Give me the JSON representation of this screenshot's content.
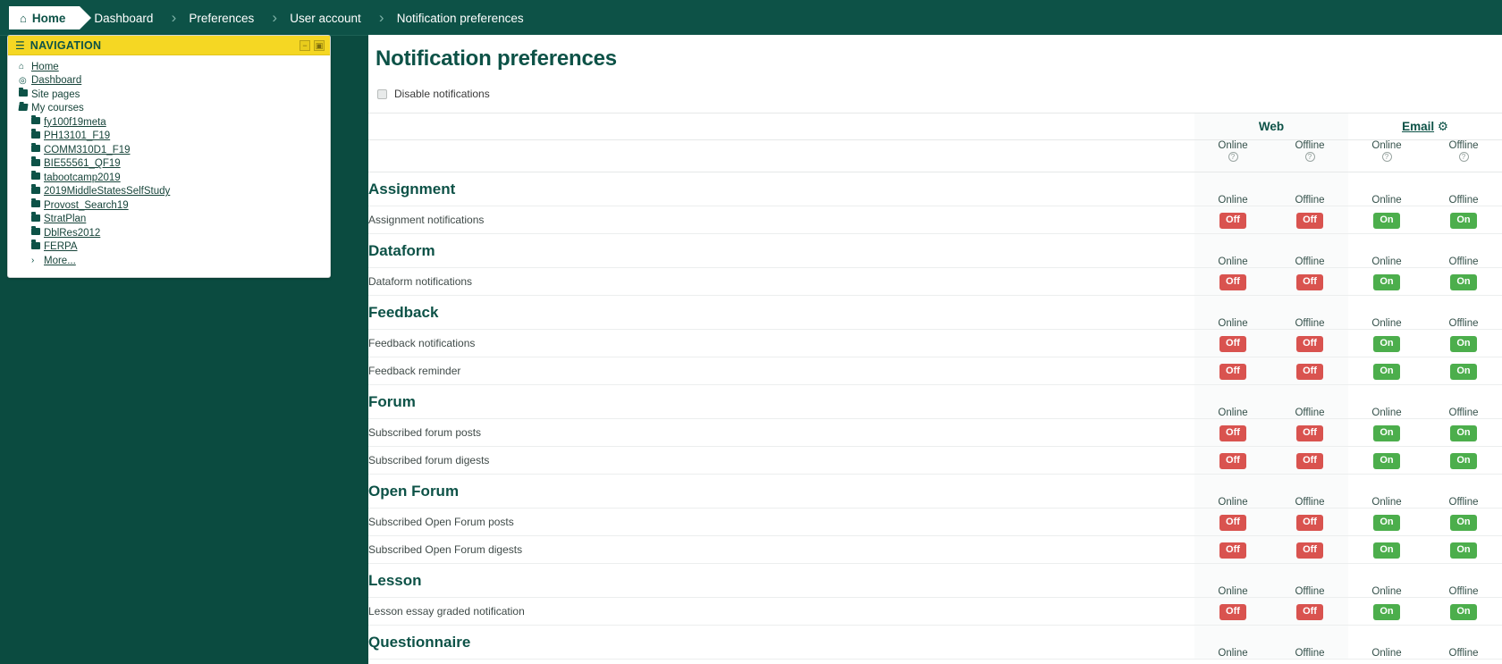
{
  "breadcrumb": {
    "home_label": "Home",
    "home_icon": "home-icon",
    "items": [
      {
        "label": "Dashboard"
      },
      {
        "label": "Preferences"
      },
      {
        "label": "User account"
      },
      {
        "label": "Notification preferences"
      }
    ],
    "separator": "›"
  },
  "sidebar": {
    "title": "NAVIGATION",
    "block_icon": "sitemap-icon",
    "controls": [
      {
        "name": "collapse-block-button",
        "glyph": "−"
      },
      {
        "name": "dock-block-button",
        "glyph": "▣"
      }
    ],
    "items": [
      {
        "label": "Home",
        "icon": "home-icon",
        "level": 1,
        "link": true
      },
      {
        "label": "Dashboard",
        "icon": "dashboard-icon",
        "level": 1,
        "link": true
      },
      {
        "label": "Site pages",
        "icon": "folder-icon",
        "level": 1,
        "link": false
      },
      {
        "label": "My courses",
        "icon": "folder-open-icon",
        "level": 1,
        "link": false
      },
      {
        "label": "fy100f19meta",
        "icon": "folder-icon",
        "level": 2,
        "link": true
      },
      {
        "label": "PH13101_F19",
        "icon": "folder-icon",
        "level": 2,
        "link": true
      },
      {
        "label": "COMM310D1_F19",
        "icon": "folder-icon",
        "level": 2,
        "link": true
      },
      {
        "label": "BIE55561_QF19",
        "icon": "folder-icon",
        "level": 2,
        "link": true
      },
      {
        "label": "tabootcamp2019",
        "icon": "folder-icon",
        "level": 2,
        "link": true
      },
      {
        "label": "2019MiddleStatesSelfStudy",
        "icon": "folder-icon",
        "level": 2,
        "link": true
      },
      {
        "label": "Provost_Search19",
        "icon": "folder-icon",
        "level": 2,
        "link": true
      },
      {
        "label": "StratPlan",
        "icon": "folder-icon",
        "level": 2,
        "link": true
      },
      {
        "label": "DblRes2012",
        "icon": "folder-icon",
        "level": 2,
        "link": true
      },
      {
        "label": "FERPA",
        "icon": "folder-icon",
        "level": 2,
        "link": true
      },
      {
        "label": "More...",
        "icon": "chevron-right-icon",
        "level": 3,
        "link": true
      }
    ]
  },
  "main": {
    "title": "Notification preferences",
    "disable_notifications": {
      "label": "Disable notifications",
      "checked": false
    },
    "providers": [
      {
        "name": "Web",
        "link": false,
        "gear": false
      },
      {
        "name": "Email",
        "link": true,
        "gear": true,
        "gear_icon": "gear-icon"
      }
    ],
    "state_columns": [
      "Online",
      "Offline",
      "Online",
      "Offline"
    ],
    "help_glyph": "?",
    "toggle_on_label": "On",
    "toggle_off_label": "Off",
    "sections": [
      {
        "title": "Assignment",
        "rows": [
          {
            "label": "Assignment notifications",
            "states": [
              "Off",
              "Off",
              "On",
              "On"
            ]
          }
        ]
      },
      {
        "title": "Dataform",
        "rows": [
          {
            "label": "Dataform notifications",
            "states": [
              "Off",
              "Off",
              "On",
              "On"
            ]
          }
        ]
      },
      {
        "title": "Feedback",
        "rows": [
          {
            "label": "Feedback notifications",
            "states": [
              "Off",
              "Off",
              "On",
              "On"
            ]
          },
          {
            "label": "Feedback reminder",
            "states": [
              "Off",
              "Off",
              "On",
              "On"
            ]
          }
        ]
      },
      {
        "title": "Forum",
        "rows": [
          {
            "label": "Subscribed forum posts",
            "states": [
              "Off",
              "Off",
              "On",
              "On"
            ]
          },
          {
            "label": "Subscribed forum digests",
            "states": [
              "Off",
              "Off",
              "On",
              "On"
            ]
          }
        ]
      },
      {
        "title": "Open Forum",
        "rows": [
          {
            "label": "Subscribed Open Forum posts",
            "states": [
              "Off",
              "Off",
              "On",
              "On"
            ]
          },
          {
            "label": "Subscribed Open Forum digests",
            "states": [
              "Off",
              "Off",
              "On",
              "On"
            ]
          }
        ]
      },
      {
        "title": "Lesson",
        "rows": [
          {
            "label": "Lesson essay graded notification",
            "states": [
              "Off",
              "Off",
              "On",
              "On"
            ]
          }
        ]
      },
      {
        "title": "Questionnaire",
        "rows": []
      }
    ]
  },
  "colors": {
    "brand_green": "#0d5247",
    "page_bg": "#0b4b40",
    "block_header_yellow": "#f5d723",
    "toggle_off_red": "#d9534f",
    "toggle_on_green": "#4cae4c"
  }
}
